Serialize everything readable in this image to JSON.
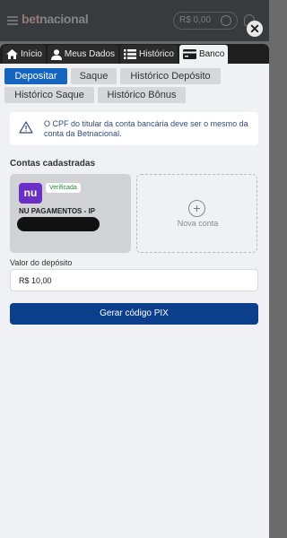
{
  "background": {
    "logo_prefix": "bet",
    "logo_suffix": "nacional",
    "balance": "R$ 0,00"
  },
  "close_glyph": "✕",
  "top_tabs": [
    {
      "label": "Início",
      "icon": "home-icon"
    },
    {
      "label": "Meus Dados",
      "icon": "user-icon"
    },
    {
      "label": "Histórico",
      "icon": "list-icon"
    },
    {
      "label": "Banco",
      "icon": "card-icon",
      "active": true
    }
  ],
  "sub_tabs": [
    {
      "label": "Depositar",
      "active": true
    },
    {
      "label": "Saque"
    },
    {
      "label": "Histórico Depósito"
    },
    {
      "label": "Histórico Saque"
    },
    {
      "label": "Histórico Bônus"
    }
  ],
  "notice": {
    "text": "O CPF do titular da conta bancária deve ser o mesmo da conta da Betnacional.",
    "icon": "warning-icon"
  },
  "accounts": {
    "title": "Contas cadastradas",
    "items": [
      {
        "logo": "nu",
        "badge": "Verificada",
        "bank": "NU PAGAMENTOS - IP"
      }
    ],
    "new_account_label": "Nova conta"
  },
  "deposit": {
    "label": "Valor do depósito",
    "value": "R$ 10,00"
  },
  "pix_button": "Gerar código PIX",
  "colors": {
    "primary": "#1565c0",
    "button": "#0b3f8c",
    "nubank": "#6b2fc6",
    "verified": "#1e8a3a"
  }
}
